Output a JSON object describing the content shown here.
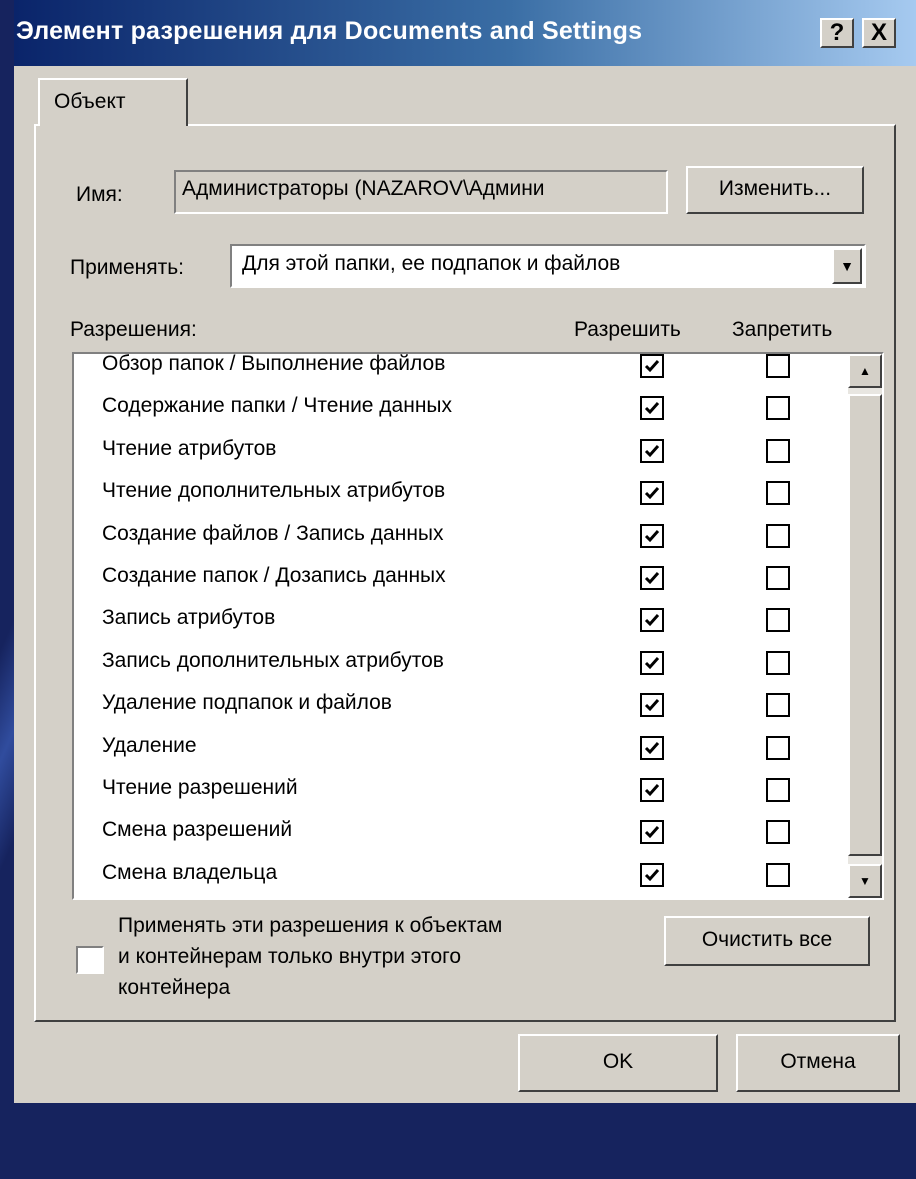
{
  "window": {
    "title": "Элемент разрешения для Documents and Settings",
    "help_button": "?",
    "close_button": "X"
  },
  "tab": {
    "label": "Объект"
  },
  "name_row": {
    "label": "Имя:",
    "value": "Администраторы (NAZAROV\\Админи",
    "change_button": "Изменить..."
  },
  "apply_row": {
    "label": "Применять:",
    "selected": "Для этой папки, ее подпапок и файлов"
  },
  "permissions": {
    "header": "Разрешения:",
    "allow_header": "Разрешить",
    "deny_header": "Запретить",
    "items": [
      {
        "label": "Обзор папок / Выполнение файлов",
        "allow": true,
        "deny": false
      },
      {
        "label": "Содержание папки / Чтение данных",
        "allow": true,
        "deny": false
      },
      {
        "label": "Чтение атрибутов",
        "allow": true,
        "deny": false
      },
      {
        "label": "Чтение дополнительных атрибутов",
        "allow": true,
        "deny": false
      },
      {
        "label": "Создание файлов / Запись данных",
        "allow": true,
        "deny": false
      },
      {
        "label": "Создание папок / Дозапись данных",
        "allow": true,
        "deny": false
      },
      {
        "label": "Запись атрибутов",
        "allow": true,
        "deny": false
      },
      {
        "label": "Запись дополнительных атрибутов",
        "allow": true,
        "deny": false
      },
      {
        "label": "Удаление подпапок и файлов",
        "allow": true,
        "deny": false
      },
      {
        "label": "Удаление",
        "allow": true,
        "deny": false
      },
      {
        "label": "Чтение разрешений",
        "allow": true,
        "deny": false
      },
      {
        "label": "Смена разрешений",
        "allow": true,
        "deny": false
      },
      {
        "label": "Смена владельца",
        "allow": true,
        "deny": false
      }
    ]
  },
  "inherit_option": {
    "checked": false,
    "line1": "Применять эти разрешения к объектам",
    "line2": "и контейнерам только внутри этого",
    "line3": "контейнера"
  },
  "clear_button": "Очистить все",
  "ok_button": "OK",
  "cancel_button": "Отмена"
}
